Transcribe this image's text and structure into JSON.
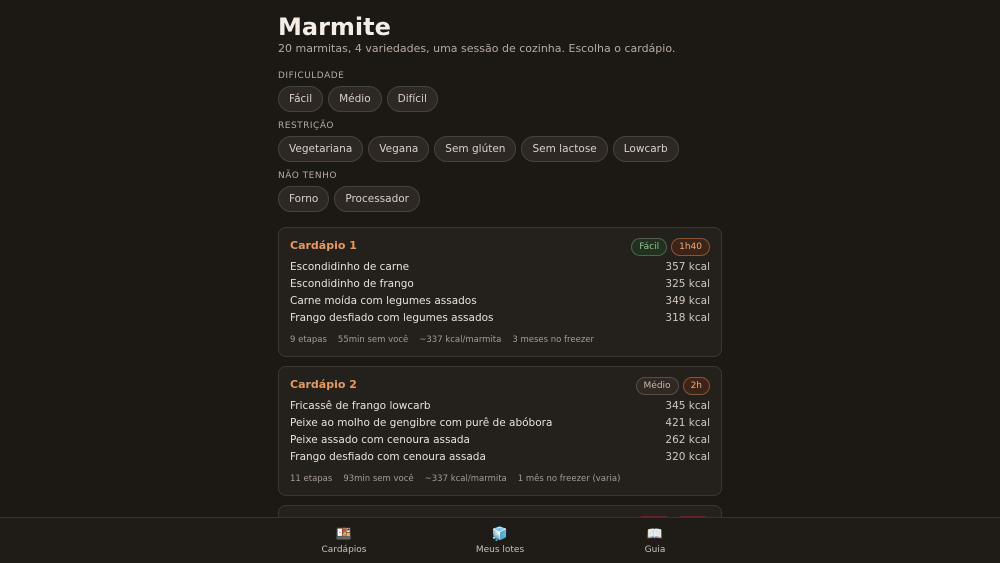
{
  "header": {
    "title": "Marmite",
    "subtitle": "20 marmitas, 4 variedades, uma sessão de cozinha. Escolha o cardápio."
  },
  "filters": {
    "difficulty": {
      "label": "DIFICULDADE",
      "options": [
        "Fácil",
        "Médio",
        "Difícil"
      ]
    },
    "restriction": {
      "label": "RESTRIÇÃO",
      "options": [
        "Vegetariana",
        "Vegana",
        "Sem glúten",
        "Sem lactose",
        "Lowcarb"
      ]
    },
    "missing": {
      "label": "NÃO TENHO",
      "options": [
        "Forno",
        "Processador"
      ]
    }
  },
  "menus": [
    {
      "title": "Cardápio 1",
      "difficulty": "Fácil",
      "time": "1h40",
      "meals": [
        {
          "name": "Escondidinho de carne",
          "kcal": "357 kcal"
        },
        {
          "name": "Escondidinho de frango",
          "kcal": "325 kcal"
        },
        {
          "name": "Carne moída com legumes assados",
          "kcal": "349 kcal"
        },
        {
          "name": "Frango desfiado com legumes assados",
          "kcal": "318 kcal"
        }
      ],
      "meta": [
        "9 etapas",
        "55min sem você",
        "~337 kcal/marmita",
        "3 meses no freezer"
      ]
    },
    {
      "title": "Cardápio 2",
      "difficulty": "Médio",
      "time": "2h",
      "meals": [
        {
          "name": "Fricassê de frango lowcarb",
          "kcal": "345 kcal"
        },
        {
          "name": "Peixe ao molho de gengibre com purê de abóbora",
          "kcal": "421 kcal"
        },
        {
          "name": "Peixe assado com cenoura assada",
          "kcal": "262 kcal"
        },
        {
          "name": "Frango desfiado com cenoura assada",
          "kcal": "320 kcal"
        }
      ],
      "meta": [
        "11 etapas",
        "93min sem você",
        "~337 kcal/marmita",
        "1 mês no freezer (varia)"
      ]
    }
  ],
  "nav": {
    "items": [
      {
        "label": "Cardápios",
        "icon": "menu-board-icon",
        "glyph": "🍱"
      },
      {
        "label": "Meus lotes",
        "icon": "ice-cube-icon",
        "glyph": "🧊"
      },
      {
        "label": "Guia",
        "icon": "open-book-icon",
        "glyph": "📖"
      }
    ]
  },
  "colors": {
    "accent": "#e89a5e",
    "background": "#1c1814",
    "card": "#24201c"
  }
}
